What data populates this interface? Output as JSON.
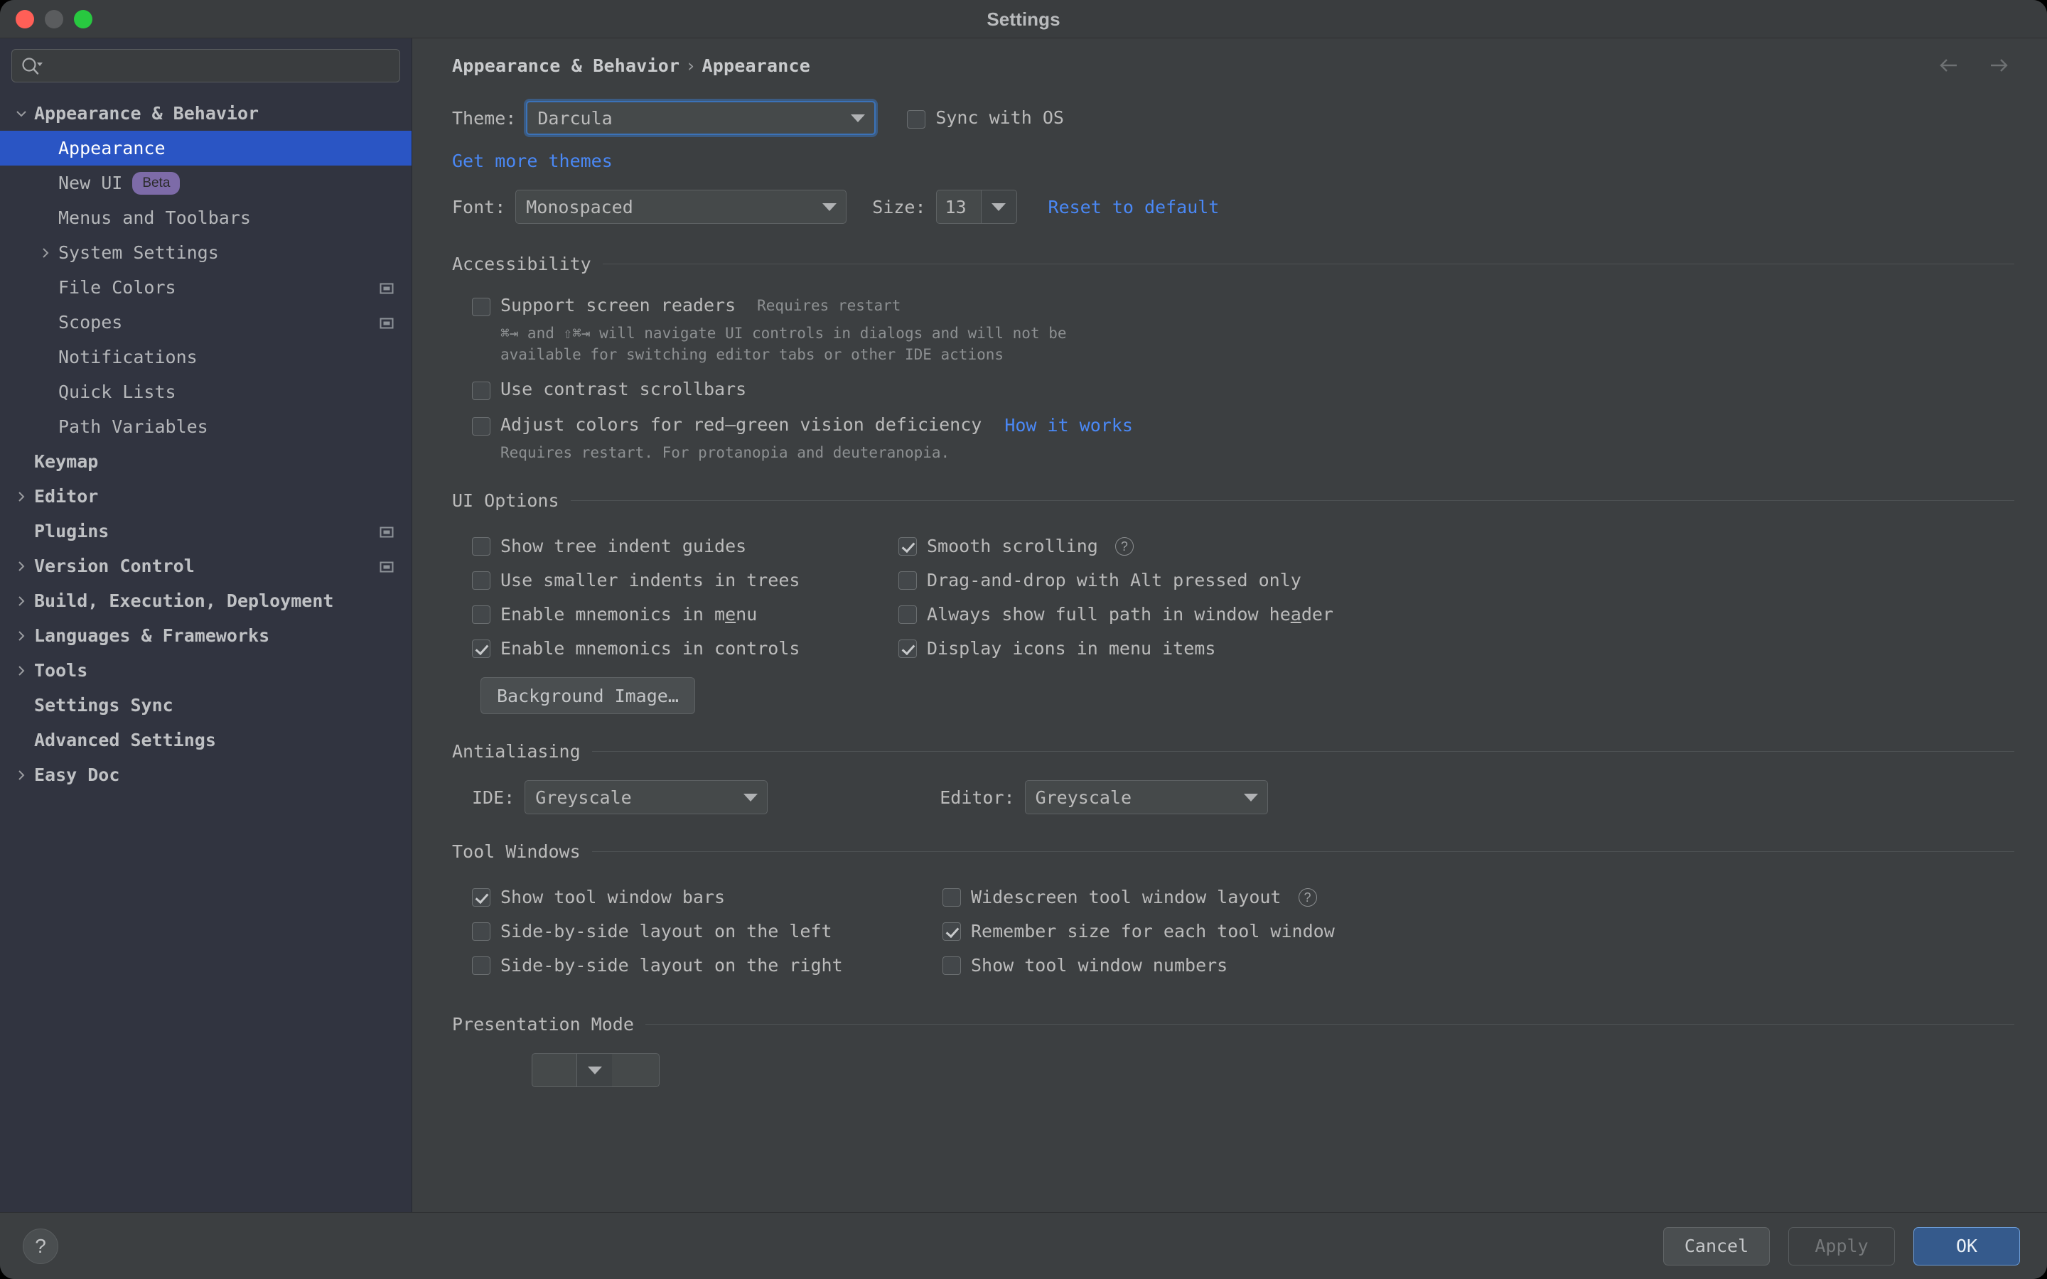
{
  "window": {
    "title": "Settings",
    "traffic_lights": [
      "close",
      "minimize",
      "zoom"
    ]
  },
  "sidebar": {
    "search": {
      "value": "",
      "placeholder": ""
    },
    "items": [
      {
        "label": "Appearance & Behavior",
        "depth": 0,
        "twisty": "down",
        "bold": true,
        "selected": false,
        "badge": null,
        "cfg_icon": false
      },
      {
        "label": "Appearance",
        "depth": 1,
        "twisty": "none",
        "bold": false,
        "selected": true,
        "badge": null,
        "cfg_icon": false
      },
      {
        "label": "New UI",
        "depth": 1,
        "twisty": "none",
        "bold": false,
        "selected": false,
        "badge": "Beta",
        "cfg_icon": false
      },
      {
        "label": "Menus and Toolbars",
        "depth": 1,
        "twisty": "none",
        "bold": false,
        "selected": false,
        "badge": null,
        "cfg_icon": false
      },
      {
        "label": "System Settings",
        "depth": 1,
        "twisty": "right",
        "bold": false,
        "selected": false,
        "badge": null,
        "cfg_icon": false
      },
      {
        "label": "File Colors",
        "depth": 1,
        "twisty": "none",
        "bold": false,
        "selected": false,
        "badge": null,
        "cfg_icon": true
      },
      {
        "label": "Scopes",
        "depth": 1,
        "twisty": "none",
        "bold": false,
        "selected": false,
        "badge": null,
        "cfg_icon": true
      },
      {
        "label": "Notifications",
        "depth": 1,
        "twisty": "none",
        "bold": false,
        "selected": false,
        "badge": null,
        "cfg_icon": false
      },
      {
        "label": "Quick Lists",
        "depth": 1,
        "twisty": "none",
        "bold": false,
        "selected": false,
        "badge": null,
        "cfg_icon": false
      },
      {
        "label": "Path Variables",
        "depth": 1,
        "twisty": "none",
        "bold": false,
        "selected": false,
        "badge": null,
        "cfg_icon": false
      },
      {
        "label": "Keymap",
        "depth": 0,
        "twisty": "none",
        "bold": true,
        "selected": false,
        "badge": null,
        "cfg_icon": false
      },
      {
        "label": "Editor",
        "depth": 0,
        "twisty": "right",
        "bold": true,
        "selected": false,
        "badge": null,
        "cfg_icon": false
      },
      {
        "label": "Plugins",
        "depth": 0,
        "twisty": "none",
        "bold": true,
        "selected": false,
        "badge": null,
        "cfg_icon": true
      },
      {
        "label": "Version Control",
        "depth": 0,
        "twisty": "right",
        "bold": true,
        "selected": false,
        "badge": null,
        "cfg_icon": true
      },
      {
        "label": "Build, Execution, Deployment",
        "depth": 0,
        "twisty": "right",
        "bold": true,
        "selected": false,
        "badge": null,
        "cfg_icon": false
      },
      {
        "label": "Languages & Frameworks",
        "depth": 0,
        "twisty": "right",
        "bold": true,
        "selected": false,
        "badge": null,
        "cfg_icon": false
      },
      {
        "label": "Tools",
        "depth": 0,
        "twisty": "right",
        "bold": true,
        "selected": false,
        "badge": null,
        "cfg_icon": false
      },
      {
        "label": "Settings Sync",
        "depth": 0,
        "twisty": "none",
        "bold": true,
        "selected": false,
        "badge": null,
        "cfg_icon": false
      },
      {
        "label": "Advanced Settings",
        "depth": 0,
        "twisty": "none",
        "bold": true,
        "selected": false,
        "badge": null,
        "cfg_icon": false
      },
      {
        "label": "Easy Doc",
        "depth": 0,
        "twisty": "right",
        "bold": true,
        "selected": false,
        "badge": null,
        "cfg_icon": false
      }
    ]
  },
  "content": {
    "breadcrumb": {
      "parent": "Appearance & Behavior",
      "separator": "›",
      "current": "Appearance"
    },
    "theme": {
      "label": "Theme:",
      "value": "Darcula",
      "sync_with_os_label": "Sync with OS",
      "sync_with_os_checked": false,
      "get_more_themes_link": "Get more themes"
    },
    "font": {
      "label": "Font:",
      "value": "Monospaced",
      "size_label": "Size:",
      "size_value": "13",
      "reset_link": "Reset to default"
    },
    "accessibility": {
      "title": "Accessibility",
      "screen_readers": {
        "label": "Support screen readers",
        "suffix": "Requires restart",
        "checked": false,
        "hint_line1": "⌘⇥ and ⇧⌘⇥ will navigate UI controls in dialogs and will not be",
        "hint_line2": "available for switching editor tabs or other IDE actions"
      },
      "contrast_scrollbars": {
        "label": "Use contrast scrollbars",
        "checked": false
      },
      "red_green": {
        "label": "Adjust colors for red–green vision deficiency",
        "link": "How it works",
        "checked": false,
        "hint": "Requires restart. For protanopia and deuteranopia."
      }
    },
    "ui_options": {
      "title": "UI Options",
      "left": [
        {
          "label": "Show tree indent guides",
          "checked": false,
          "mnemonic": null
        },
        {
          "label": "Use smaller indents in trees",
          "checked": false,
          "mnemonic": null
        },
        {
          "label": "Enable mnemonics in menu",
          "checked": false,
          "mnemonic": "e"
        },
        {
          "label": "Enable mnemonics in controls",
          "checked": true,
          "mnemonic": null
        }
      ],
      "right": [
        {
          "label": "Smooth scrolling",
          "checked": true,
          "help": true,
          "mnemonic": null
        },
        {
          "label": "Drag-and-drop with Alt pressed only",
          "checked": false,
          "help": false,
          "mnemonic": null
        },
        {
          "label": "Always show full path in window header",
          "checked": false,
          "help": false,
          "mnemonic": "a"
        },
        {
          "label": "Display icons in menu items",
          "checked": true,
          "help": false,
          "mnemonic": null
        }
      ],
      "background_image_button": "Background Image…"
    },
    "antialiasing": {
      "title": "Antialiasing",
      "ide_label": "IDE:",
      "ide_value": "Greyscale",
      "editor_label": "Editor:",
      "editor_value": "Greyscale"
    },
    "tool_windows": {
      "title": "Tool Windows",
      "left": [
        {
          "label": "Show tool window bars",
          "checked": true,
          "help": false
        },
        {
          "label": "Side-by-side layout on the left",
          "checked": false,
          "help": false
        },
        {
          "label": "Side-by-side layout on the right",
          "checked": false,
          "help": false
        }
      ],
      "right": [
        {
          "label": "Widescreen tool window layout",
          "checked": false,
          "help": true
        },
        {
          "label": "Remember size for each tool window",
          "checked": true,
          "help": false
        },
        {
          "label": "Show tool window numbers",
          "checked": false,
          "help": false
        }
      ]
    },
    "presentation_mode": {
      "title": "Presentation Mode"
    }
  },
  "footer": {
    "help_glyph": "?",
    "cancel_label": "Cancel",
    "apply_label": "Apply",
    "ok_label": "OK"
  },
  "colors": {
    "selection_blue": "#2a55c4",
    "link_blue": "#4a88f5",
    "primary_button": "#355a8c",
    "beta_badge": "#7d6ba8",
    "sidebar_bg": "#313440",
    "content_bg": "#3c3f41"
  }
}
